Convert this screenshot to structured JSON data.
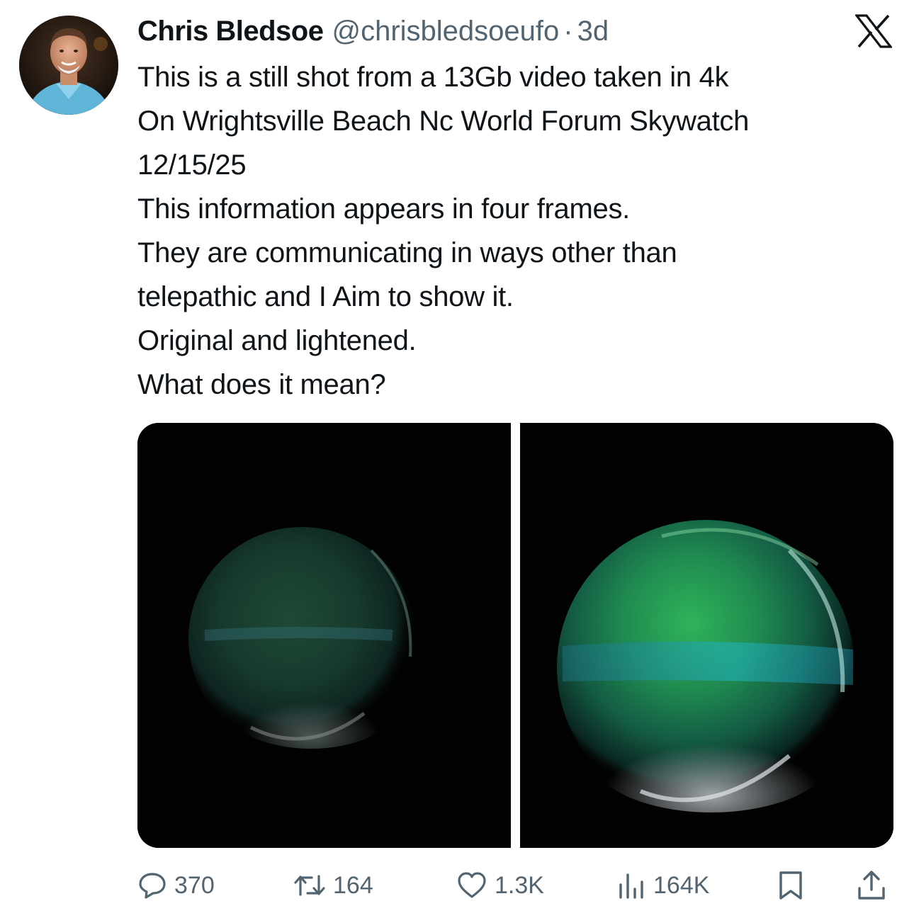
{
  "author": {
    "display_name": "Chris Bledsoe",
    "handle": "@chrisbledsoeufo",
    "separator": "·",
    "time": "3d"
  },
  "platform_icon": "x-logo-icon",
  "tweet": {
    "lines": [
      "This is a still shot from a 13Gb video taken in 4k",
      "On Wrightsville Beach Nc World Forum Skywatch",
      "12/15/25",
      "This information appears in four frames.",
      "They are communicating in ways other than",
      "telepathic and I Aim to show it.",
      "Original and lightened.",
      "What does it mean?"
    ]
  },
  "media": {
    "images": [
      {
        "label": "original",
        "icon": "glowing-orb-image"
      },
      {
        "label": "lightened",
        "icon": "glowing-orb-image"
      }
    ]
  },
  "actions": {
    "replies": "370",
    "reposts": "164",
    "likes": "1.3K",
    "views": "164K",
    "icons": [
      "reply-icon",
      "repost-icon",
      "like-icon",
      "views-icon",
      "bookmark-icon",
      "share-icon"
    ]
  },
  "colors": {
    "text": "#0f1419",
    "secondary": "#536471",
    "orb_green": "#2fb35a",
    "orb_teal": "#22b5c8"
  }
}
